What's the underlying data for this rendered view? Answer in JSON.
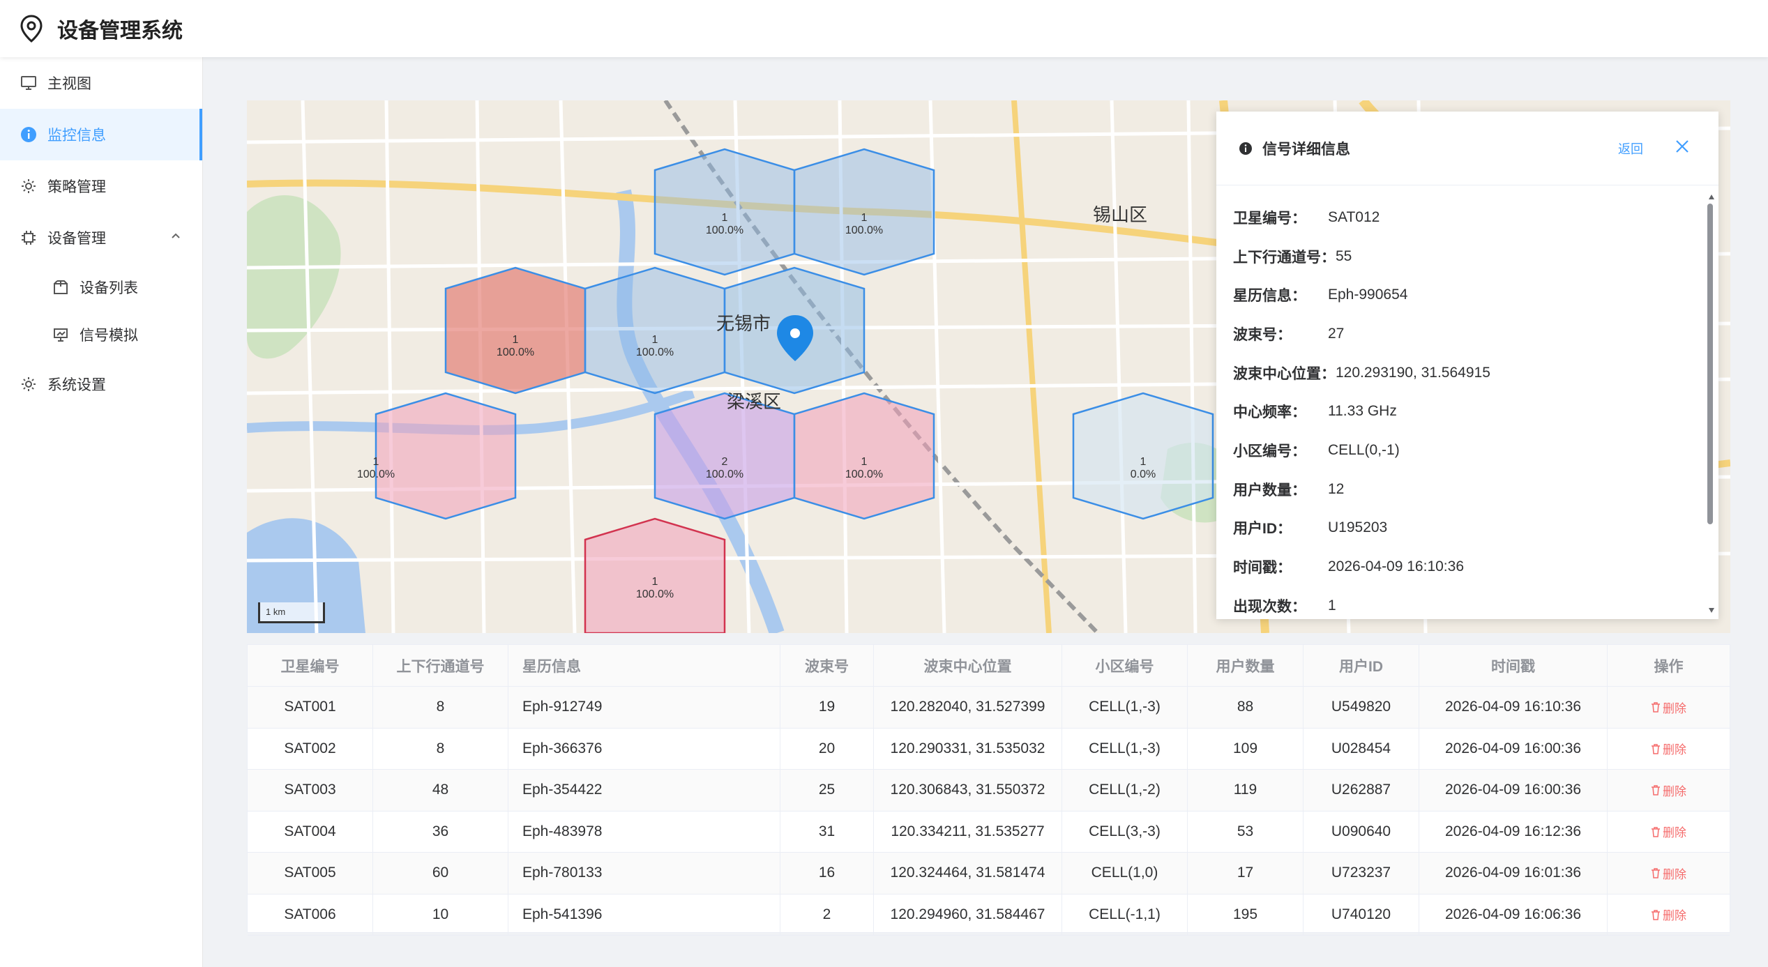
{
  "app": {
    "title": "设备管理系统",
    "logo_icon": "location-pin-icon"
  },
  "sidebar": {
    "items": [
      {
        "label": "主视图",
        "icon": "monitor-icon"
      },
      {
        "label": "监控信息",
        "icon": "info-icon",
        "active": true
      },
      {
        "label": "策略管理",
        "icon": "gear-icon"
      },
      {
        "label": "设备管理",
        "icon": "chip-icon",
        "expanded": true,
        "children": [
          {
            "label": "设备列表",
            "icon": "box-icon"
          },
          {
            "label": "信号模拟",
            "icon": "presentation-icon"
          }
        ]
      },
      {
        "label": "系统设置",
        "icon": "gear-icon"
      }
    ]
  },
  "map": {
    "labels": {
      "city": "无锡市",
      "district1": "梁溪区",
      "district2": "锡山区"
    },
    "scale": "1 km",
    "hexes": [
      {
        "count": "1",
        "pct": "100.0%",
        "color": "#a9c8e8"
      },
      {
        "count": "1",
        "pct": "100.0%",
        "color": "#a9c8e8"
      },
      {
        "count": "1",
        "pct": "100.0%",
        "color": "#e58a82"
      },
      {
        "count": "1",
        "pct": "100.0%",
        "color": "#a9c8e8"
      },
      {
        "count": "1",
        "pct": "100.0%",
        "color": "#f0b3c3"
      },
      {
        "count": "2",
        "pct": "100.0%",
        "color": "#c9a9e6"
      },
      {
        "count": "1",
        "pct": "100.0%",
        "color": "#f0b3c3"
      },
      {
        "count": "1",
        "pct": "0.0%",
        "color": "#d8e6f2"
      },
      {
        "count": "1",
        "pct": "100.0%",
        "color": "#f0b3c3"
      }
    ]
  },
  "detail": {
    "title": "信号详细信息",
    "back": "返回",
    "fields": [
      {
        "k": "卫星编号：",
        "v": "SAT012"
      },
      {
        "k": "上下行通道号：",
        "v": "55"
      },
      {
        "k": "星历信息：",
        "v": "Eph-990654"
      },
      {
        "k": "波束号：",
        "v": "27"
      },
      {
        "k": "波束中心位置：",
        "v": "120.293190, 31.564915"
      },
      {
        "k": "中心频率：",
        "v": "11.33 GHz"
      },
      {
        "k": "小区编号：",
        "v": "CELL(0,-1)"
      },
      {
        "k": "用户数量：",
        "v": "12"
      },
      {
        "k": "用户ID：",
        "v": "U195203"
      },
      {
        "k": "时间戳：",
        "v": "2026-04-09 16:10:36"
      },
      {
        "k": "出现次数：",
        "v": "1"
      }
    ]
  },
  "table": {
    "headers": [
      "卫星编号",
      "上下行通道号",
      "星历信息",
      "波束号",
      "波束中心位置",
      "小区编号",
      "用户数量",
      "用户ID",
      "时间戳",
      "操作"
    ],
    "delete_label": "删除",
    "rows": [
      [
        "SAT001",
        "8",
        "Eph-912749",
        "19",
        "120.282040, 31.527399",
        "CELL(1,-3)",
        "88",
        "U549820",
        "2026-04-09 16:10:36"
      ],
      [
        "SAT002",
        "8",
        "Eph-366376",
        "20",
        "120.290331, 31.535032",
        "CELL(1,-3)",
        "109",
        "U028454",
        "2026-04-09 16:00:36"
      ],
      [
        "SAT003",
        "48",
        "Eph-354422",
        "25",
        "120.306843, 31.550372",
        "CELL(1,-2)",
        "119",
        "U262887",
        "2026-04-09 16:00:36"
      ],
      [
        "SAT004",
        "36",
        "Eph-483978",
        "31",
        "120.334211, 31.535277",
        "CELL(3,-3)",
        "53",
        "U090640",
        "2026-04-09 16:12:36"
      ],
      [
        "SAT005",
        "60",
        "Eph-780133",
        "16",
        "120.324464, 31.581474",
        "CELL(1,0)",
        "17",
        "U723237",
        "2026-04-09 16:01:36"
      ],
      [
        "SAT006",
        "10",
        "Eph-541396",
        "2",
        "120.294960, 31.584467",
        "CELL(-1,1)",
        "195",
        "U740120",
        "2026-04-09 16:06:36"
      ]
    ]
  }
}
